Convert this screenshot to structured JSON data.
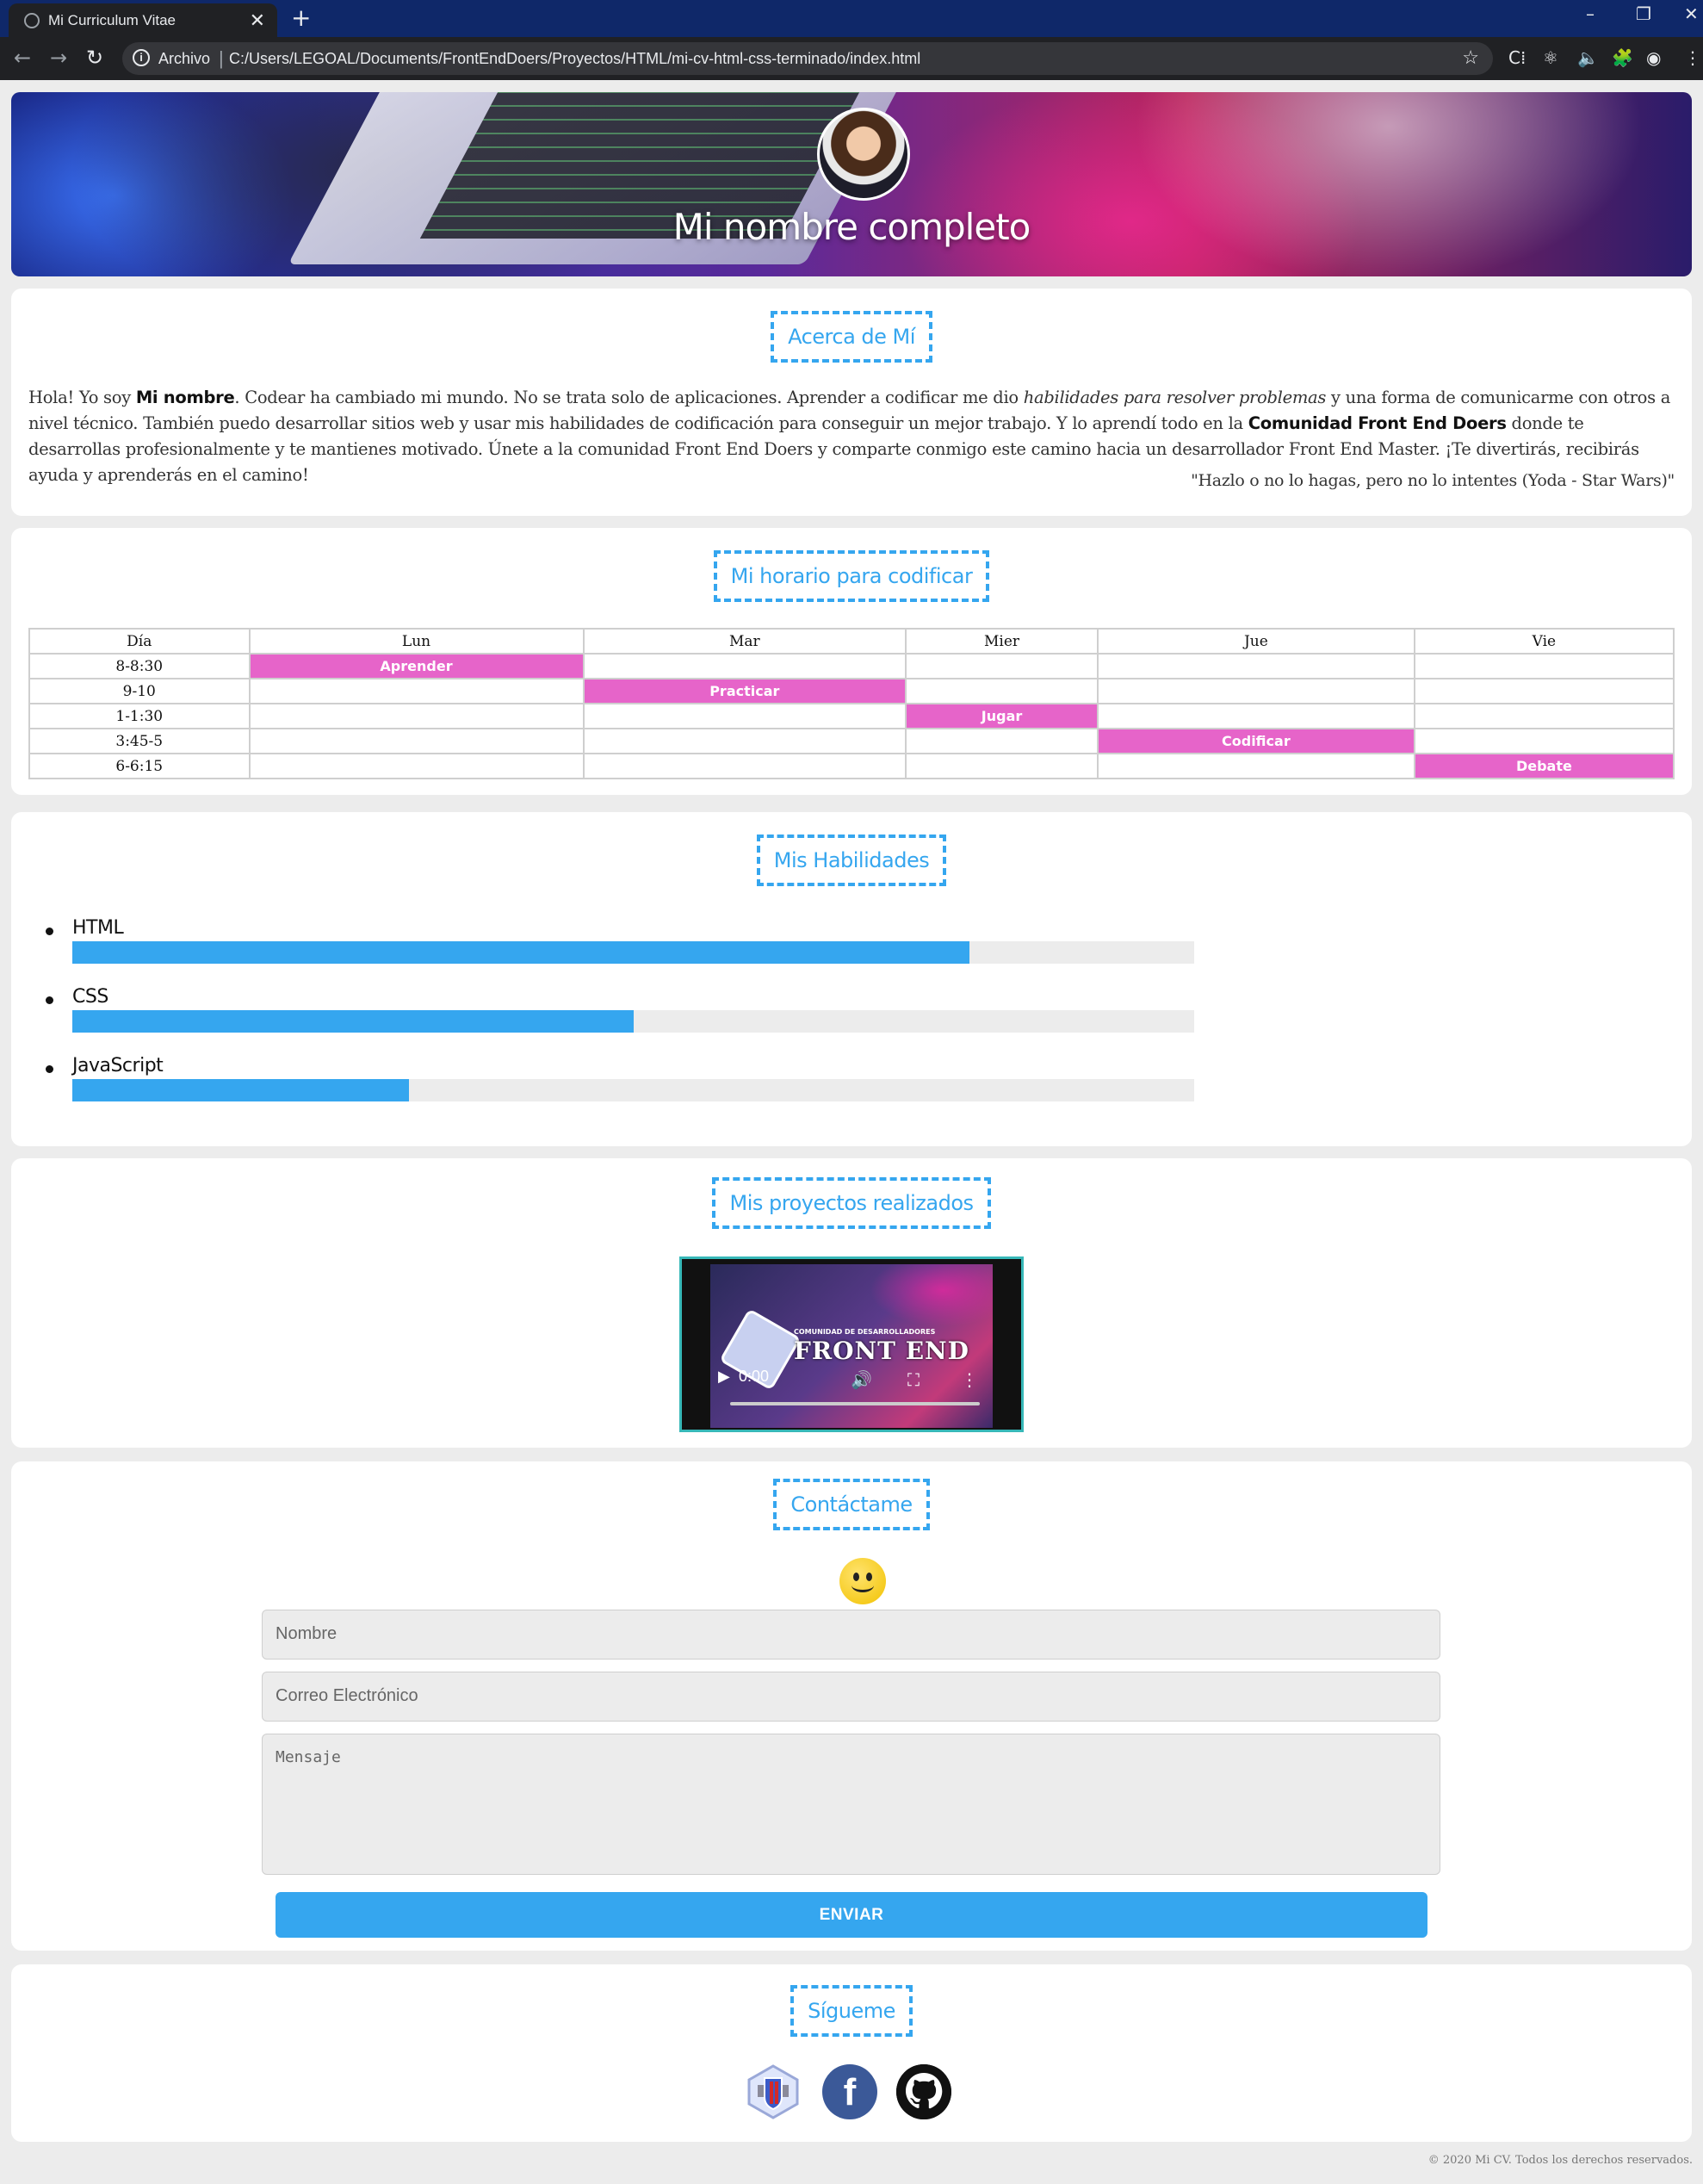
{
  "browser": {
    "tab_title": "Mi Curriculum Vitae",
    "tab_close": "✕",
    "new_tab": "+",
    "window_controls": {
      "minimize": "–",
      "restore": "❐",
      "close": "✕"
    },
    "nav": {
      "back": "←",
      "forward": "→",
      "reload": "↻"
    },
    "address": {
      "info": "i",
      "scheme": "Archivo",
      "url": "C:/Users/LEGOAL/Documents/FrontEndDoers/Proyectos/HTML/mi-cv-html-css-terminado/index.html",
      "star": "☆"
    },
    "extensions": [
      "C⁞",
      "⚛",
      "🔈",
      "🧩",
      "◉",
      "⋮"
    ]
  },
  "hero": {
    "name": "Mi nombre completo"
  },
  "about": {
    "title": "Acerca de Mí",
    "text_1": "Hola! Yo soy ",
    "bold_1": "Mi nombre",
    "text_2": ". Codear ha cambiado mi mundo. No se trata solo de aplicaciones. Aprender a codificar me dio ",
    "italic_1": "habilidades para resolver problemas",
    "text_3": " y una forma de comunicarme con otros a nivel técnico. También puedo desarrollar sitios web y usar mis habilidades de codificación para conseguir un mejor trabajo. Y lo aprendí todo en la ",
    "bold_2": "Comunidad Front End Doers",
    "text_4": " donde te desarrollas profesionalmente y te mantienes motivado. Únete a la comunidad Front End Doers y comparte conmigo este camino hacia un desarrollador Front End Master. ¡Te divertirás, recibirás ayuda y aprenderás en el camino!",
    "quote": "\"Hazlo o no lo hagas, pero no lo intentes (Yoda - Star Wars)\""
  },
  "schedule": {
    "title": "Mi horario para codificar",
    "headers": [
      "Día",
      "Lun",
      "Mar",
      "Mier",
      "Jue",
      "Vie"
    ],
    "rows": [
      {
        "time": "8-8:30",
        "cells": [
          "Aprender",
          "",
          "",
          "",
          ""
        ]
      },
      {
        "time": "9-10",
        "cells": [
          "",
          "Practicar",
          "",
          "",
          ""
        ]
      },
      {
        "time": "1-1:30",
        "cells": [
          "",
          "",
          "Jugar",
          "",
          ""
        ]
      },
      {
        "time": "3:45-5",
        "cells": [
          "",
          "",
          "",
          "Codificar",
          ""
        ]
      },
      {
        "time": "6-6:15",
        "cells": [
          "",
          "",
          "",
          "",
          "Debate"
        ]
      }
    ],
    "highlight_color": "#e664c9"
  },
  "skills": {
    "title": "Mis Habilidades",
    "items": [
      {
        "name": "HTML",
        "level": 0.8
      },
      {
        "name": "CSS",
        "level": 0.5
      },
      {
        "name": "JavaScript",
        "level": 0.3
      }
    ],
    "bar_color": "#35a6ef"
  },
  "projects": {
    "title": "Mis proyectos realizados",
    "video": {
      "brand_small": "COMUNIDAD DE DESARROLLADORES",
      "brand": "FRONT END",
      "time": "0:00",
      "play_icon": "▶",
      "volume_icon": "🔊",
      "fullscreen_icon": "⛶",
      "menu_icon": "⋮"
    }
  },
  "contact": {
    "title": "Contáctame",
    "name_placeholder": "Nombre",
    "email_placeholder": "Correo Electrónico",
    "message_placeholder": "Mensaje",
    "submit_label": "ENVIAR"
  },
  "follow": {
    "title": "Sígueme",
    "facebook_glyph": "f"
  },
  "footer": {
    "text": "© 2020 Mi CV. Todos los derechos reservados."
  },
  "colors": {
    "accent": "#35a6ef",
    "browser_tabbar": "#0f2869",
    "browser_toolbar": "#202124"
  }
}
